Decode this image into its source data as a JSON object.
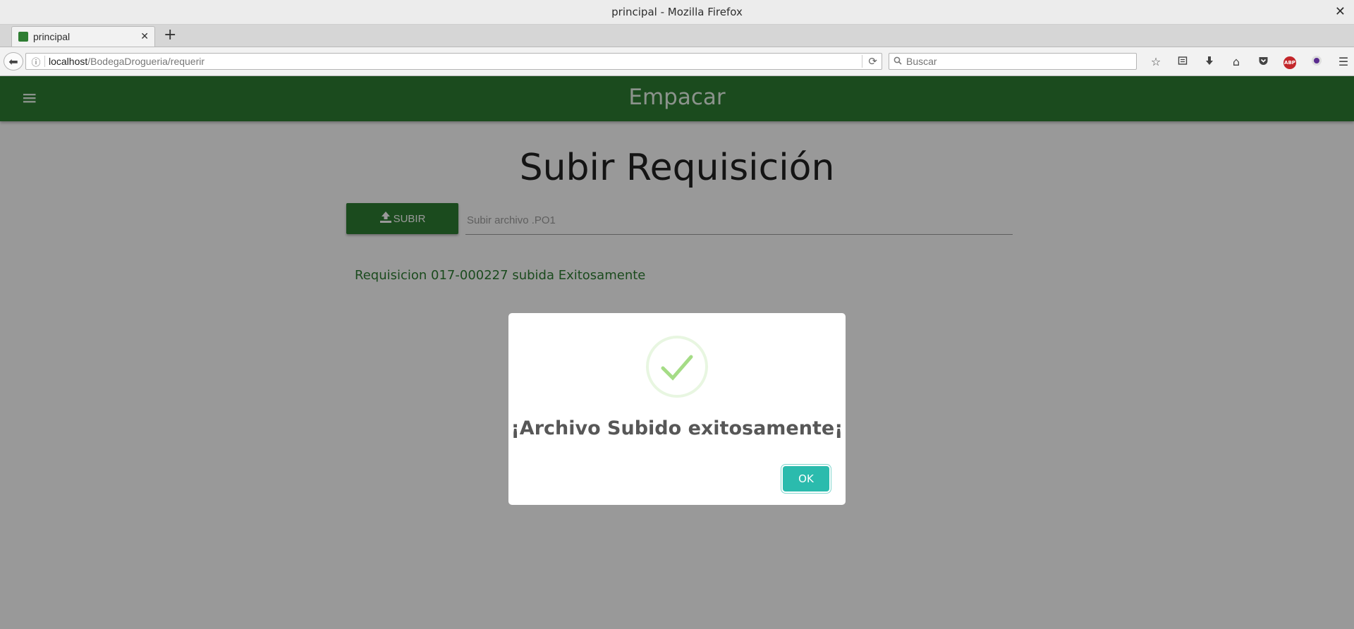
{
  "window": {
    "title": "principal - Mozilla Firefox",
    "close_glyph": "✕"
  },
  "tabs": [
    {
      "label": "principal",
      "close_glyph": "✕"
    }
  ],
  "newtab_glyph": "+",
  "navbar": {
    "back_glyph": "⬅",
    "url_host": "localhost",
    "url_path": "/BodegaDrogueria/requerir",
    "search_placeholder": "Buscar",
    "icons": [
      "bookmark-star-icon",
      "reading-list-icon",
      "download-icon",
      "home-icon",
      "pocket-icon",
      "adblock-plus-icon",
      "extension-icon",
      "menu-icon"
    ],
    "abp_text": "ABP"
  },
  "app": {
    "header_title": "Empacar",
    "menu_glyph": "≡",
    "page_heading": "Subir Requisición",
    "upload_button_label": "SUBIR",
    "file_input_placeholder": "Subir archivo .PO1",
    "status_message": "Requisicion 017-000227 subida Exitosamente",
    "accent_color": "#2e7d32"
  },
  "modal": {
    "title": "¡Archivo Subido exitosamente¡",
    "ok_label": "OK",
    "icon": "success-check-icon",
    "ok_color": "#2bbbad"
  }
}
